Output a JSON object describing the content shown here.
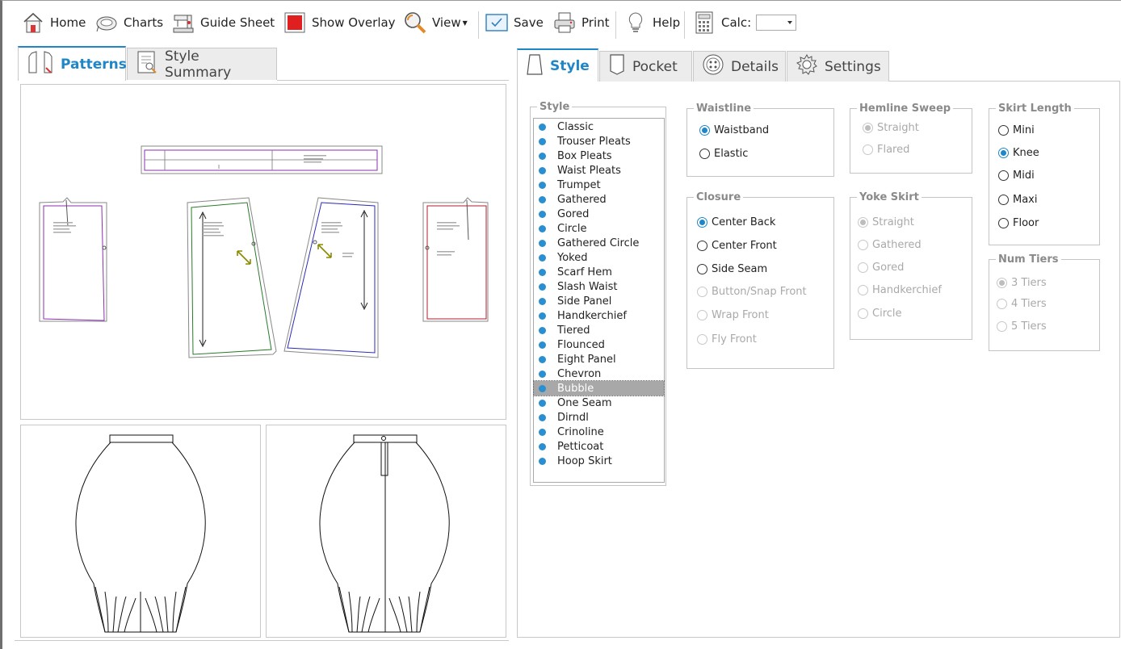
{
  "toolbar": {
    "home": "Home",
    "charts": "Charts",
    "guide_sheet": "Guide Sheet",
    "show_overlay": "Show Overlay",
    "view": "View",
    "save": "Save",
    "print": "Print",
    "help": "Help",
    "calc": "Calc:",
    "calc_value": ""
  },
  "left_tabs": {
    "patterns": "Patterns",
    "style_summary": "Style Summary"
  },
  "right_tabs": {
    "style": "Style",
    "pocket": "Pocket",
    "details": "Details",
    "settings": "Settings"
  },
  "style_group": {
    "legend": "Style",
    "items": [
      "Classic",
      "Trouser Pleats",
      "Box Pleats",
      "Waist Pleats",
      "Trumpet",
      "Gathered",
      "Gored",
      "Circle",
      "Gathered Circle",
      "Yoked",
      "Scarf Hem",
      "Slash Waist",
      "Side Panel",
      "Handkerchief",
      "Tiered",
      "Flounced",
      "Eight Panel",
      "Chevron",
      "Bubble",
      "One Seam",
      "Dirndl",
      "Crinoline",
      "Petticoat",
      "Hoop Skirt"
    ],
    "selected": "Bubble"
  },
  "waistline": {
    "legend": "Waistline",
    "options": [
      "Waistband",
      "Elastic"
    ],
    "selected": "Waistband"
  },
  "closure": {
    "legend": "Closure",
    "options": [
      "Center Back",
      "Center Front",
      "Side Seam",
      "Button/Snap Front",
      "Wrap Front",
      "Fly Front"
    ],
    "selected": "Center Back"
  },
  "hemline_sweep": {
    "legend": "Hemline Sweep",
    "options": [
      "Straight",
      "Flared"
    ],
    "selected": "Straight"
  },
  "yoke_skirt": {
    "legend": "Yoke Skirt",
    "options": [
      "Straight",
      "Gathered",
      "Gored",
      "Handkerchief",
      "Circle"
    ],
    "selected": "Straight"
  },
  "skirt_length": {
    "legend": "Skirt Length",
    "options": [
      "Mini",
      "Knee",
      "Midi",
      "Maxi",
      "Floor"
    ],
    "selected": "Knee"
  },
  "num_tiers": {
    "legend": "Num Tiers",
    "options": [
      "3 Tiers",
      "4 Tiers",
      "5 Tiers"
    ],
    "selected": "3 Tiers"
  },
  "colors": {
    "accent": "#1f86c7",
    "dot": "#2a8fd1",
    "overlay_red": "#e02020",
    "pattern_purple": "#8b2fb0",
    "pattern_green": "#2a7a2a",
    "pattern_blue": "#2b2bb8",
    "pattern_red": "#b01e2a"
  }
}
